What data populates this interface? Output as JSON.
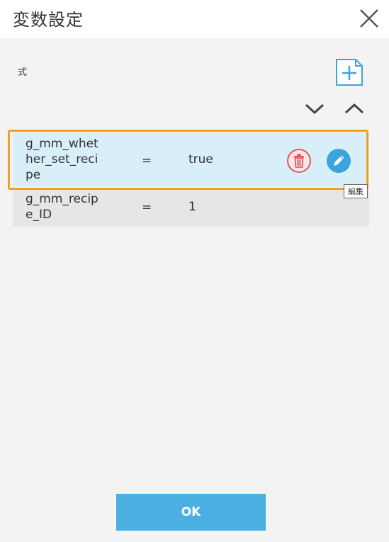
{
  "dialog": {
    "title": "変数設定",
    "close_icon": "close-icon"
  },
  "section": {
    "label": "式",
    "add_icon": "add-document-icon",
    "move_down_icon": "chevron-down-icon",
    "move_up_icon": "chevron-up-icon"
  },
  "rows": [
    {
      "name": "g_mm_whether_set_recipe",
      "op": "=",
      "value": "true",
      "selected": true
    },
    {
      "name": "g_mm_recipe_ID",
      "op": "=",
      "value": "1",
      "selected": false
    }
  ],
  "row_actions": {
    "delete_icon": "trash-icon",
    "edit_icon": "pencil-icon",
    "edit_tooltip": "編集"
  },
  "footer": {
    "ok_label": "OK"
  },
  "colors": {
    "accent": "#4ab0e2",
    "selection_border": "#f0a020",
    "selected_row": "#d8eef8",
    "row": "#e6e6e6",
    "delete": "#e05a5a"
  }
}
